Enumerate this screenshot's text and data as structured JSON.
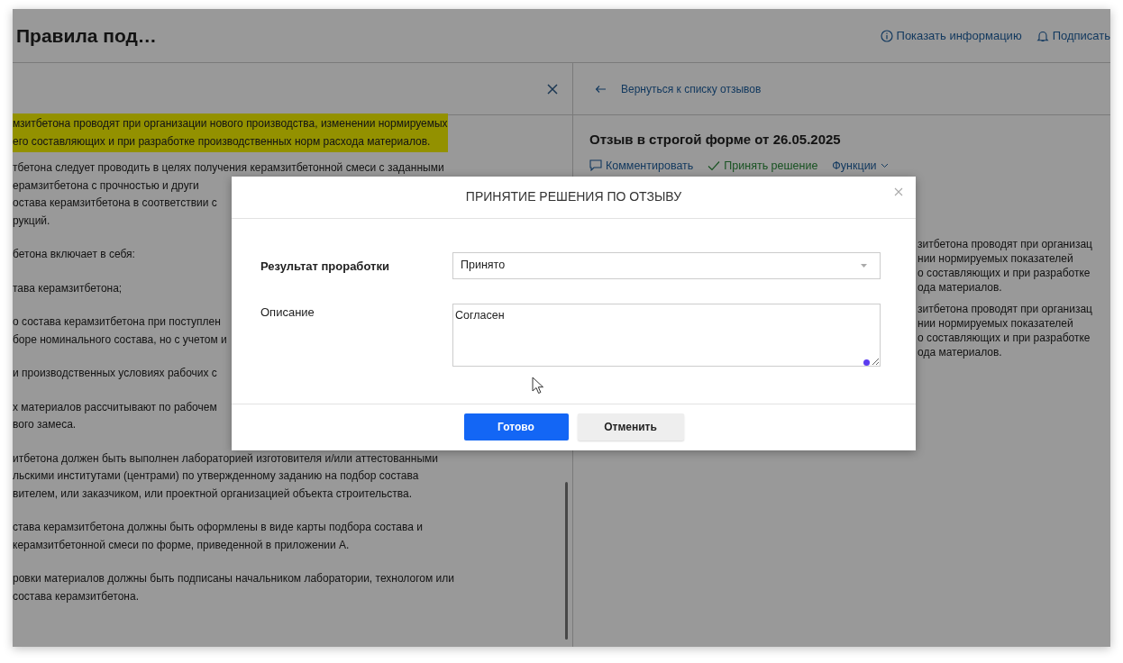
{
  "header": {
    "title": "Правила под…",
    "actions": [
      {
        "kind": "info",
        "label": "Показать информацию"
      },
      {
        "kind": "bell",
        "label": "Подписать"
      }
    ]
  },
  "document_pane": {
    "paragraphs": [
      {
        "highlighted": true,
        "lines": [
          "мзитбетона проводят при организации нового производства, изменении нормируемых",
          "его составляющих и при разработке производственных норм расхода материалов."
        ]
      },
      {
        "highlighted": false,
        "lines": [
          "тбетона следует проводить в целях получения керамзитбетонной смеси с заданными",
          "ерамзитбетона с прочностью и други",
          "остава керамзитбетона в соответствии с",
          "рукций."
        ]
      },
      {
        "highlighted": false,
        "lines": [
          "бетона включает в себя:"
        ]
      },
      {
        "highlighted": false,
        "lines": [
          "тава керамзитбетона;"
        ]
      },
      {
        "highlighted": false,
        "lines": [
          "о состава керамзитбетона при поступлен",
          "боре номинального состава, но с учетом и"
        ]
      },
      {
        "highlighted": false,
        "lines": [
          "и производственных условиях рабочих с"
        ]
      },
      {
        "highlighted": false,
        "lines": [
          "х материалов рассчитывают по рабочем",
          "вого замеса."
        ]
      },
      {
        "highlighted": false,
        "lines": [
          "итбетона должен быть выполнен лабораторией изготовителя и/или аттестованными",
          "льскими институтами (центрами) по утвержденному заданию на подбор состава",
          "вителем, или заказчиком, или проектной организацией объекта строительства."
        ]
      },
      {
        "highlighted": false,
        "lines": [
          "става керамзитбетона должны быть оформлены в виде карты подбора состава и",
          "керамзитбетонной смеси по форме, приведенной в приложении А."
        ]
      },
      {
        "highlighted": false,
        "lines": [
          "ровки материалов должны быть подписаны начальником лаборатории, технологом или",
          "состава керамзитбетона."
        ]
      }
    ]
  },
  "review_pane": {
    "back_link": "Вернуться к списку отзывов",
    "title": "Отзыв в строгой форме от 26.05.2025",
    "actions": [
      {
        "kind": "comment",
        "label": "Комментировать"
      },
      {
        "kind": "accept",
        "label": "Принять решение"
      },
      {
        "kind": "menu",
        "label": "Функции"
      }
    ],
    "paragraphs": [
      {
        "lines": [
          "зитбетона проводят при организац",
          "нии нормируемых показателей",
          "о составляющих и при разработке",
          "ода материалов."
        ]
      },
      {
        "lines": [
          "зитбетона проводят при организац",
          "нии нормируемых показателей",
          "о составляющих и при разработке",
          "ода материалов."
        ]
      }
    ]
  },
  "dialog": {
    "title": "ПРИНЯТИЕ РЕШЕНИЯ ПО ОТЗЫВУ",
    "fields": [
      {
        "kind": "select",
        "label": "Результат проработки",
        "required": true,
        "value": "Принято"
      },
      {
        "kind": "textarea",
        "label": "Описание",
        "required": false,
        "value": "Согласен"
      }
    ],
    "buttons": [
      {
        "kind": "primary",
        "label": "Готово"
      },
      {
        "kind": "secondary",
        "label": "Отменить"
      }
    ]
  }
}
